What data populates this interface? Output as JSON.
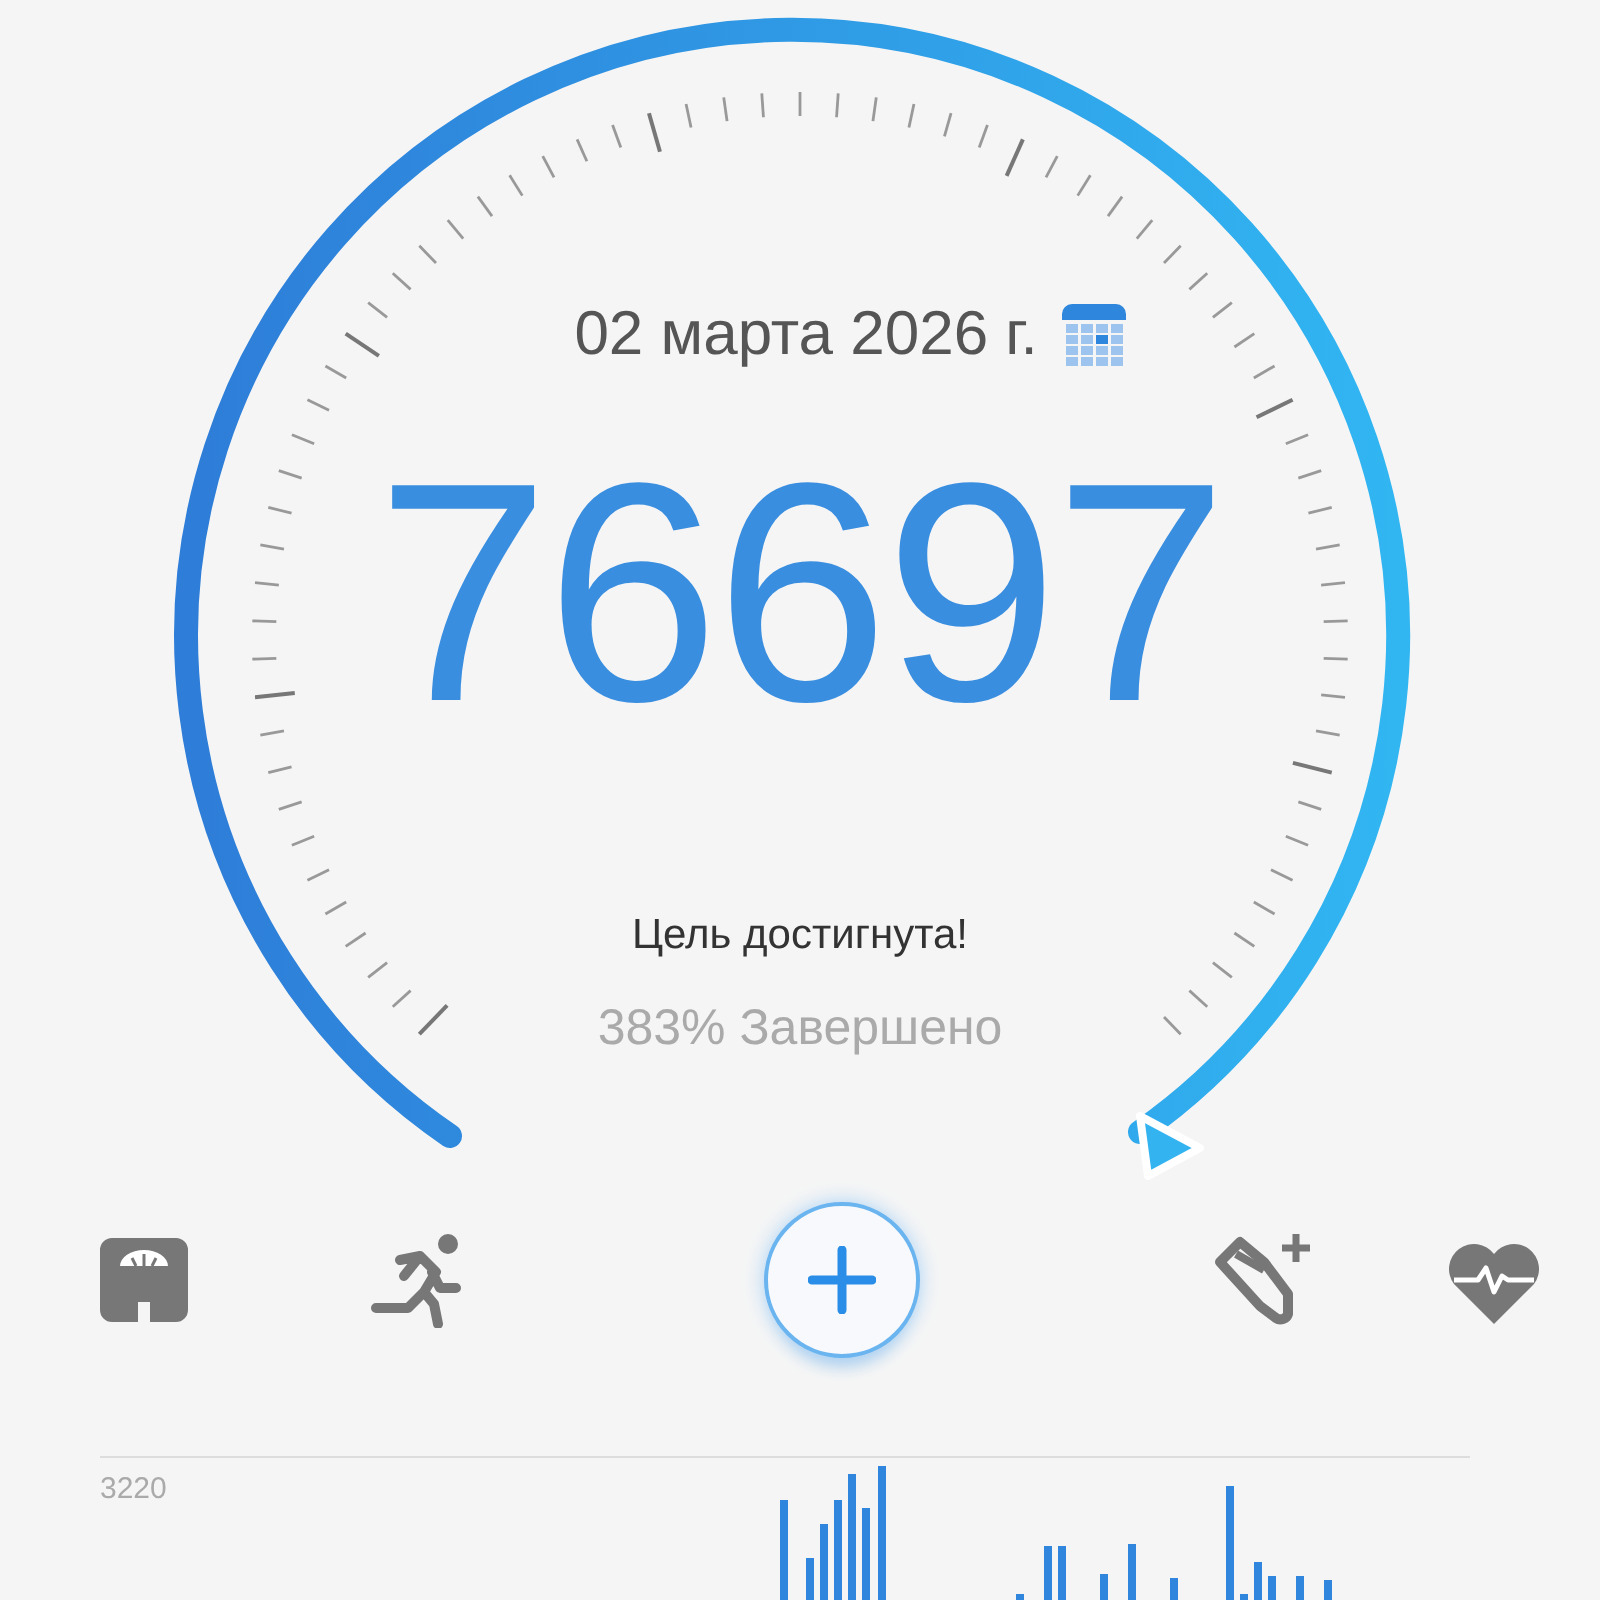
{
  "date": "02 марта 2026 г.",
  "steps": "76697",
  "goal_status": "Цель достигнута!",
  "completion": "383% Завершено",
  "chart": {
    "axis_label": "3220"
  }
}
